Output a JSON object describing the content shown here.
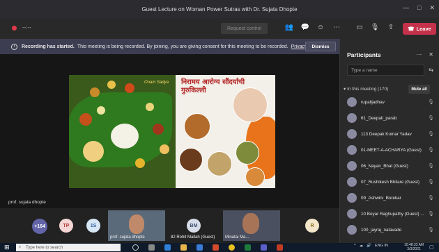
{
  "window": {
    "title": "Guest Lecture on Woman Power Sutras with Dr. Sujata Dhopte"
  },
  "toolbar": {
    "request_control": "Request control",
    "leave_label": "Leave",
    "timer": "--:--"
  },
  "banner": {
    "bold": "Recording has started.",
    "text": "This meeting is being recorded. By joining, you are giving consent for this meeting to be recorded.",
    "link": "Privacy policy",
    "dismiss": "Dismiss"
  },
  "slide": {
    "left_tag": "Onam Sadya",
    "title": "निरामय आरोग्य सौंदर्याची गुरुकिल्ली"
  },
  "presenter": {
    "name": "prof. sujata dhopte"
  },
  "strip": {
    "overflow_count": "+164",
    "avatars": [
      "TP",
      "1S",
      "BM",
      "R"
    ],
    "tiles": [
      "prof. sujata dhopte",
      "82 Rohit Mallah (Guest)",
      "Minatai Ma..."
    ]
  },
  "panel": {
    "title": "Participants",
    "search_placeholder": "Type a name",
    "in_meeting": "In this meeting (170)",
    "mute_all": "Mute all",
    "participants": [
      "rupalijadhav",
      "61_Deepali_parab",
      "113 Deepak Kumar Yadav",
      "01-MEET-A-ACHARYA (Guest)",
      "06_Nayan_Bhat (Guest)",
      "07_Rushikesh Bhilare (Guest)",
      "09_Ashwini_Borekar",
      "10 Boyar Raghupathy (Guest) ...",
      "100_jayraj_nalavade"
    ]
  },
  "taskbar": {
    "search_placeholder": "Type here to search",
    "lang": "ENG IN",
    "time": "10:48:33 AM",
    "date": "3/3/2021"
  },
  "colors": {
    "accent": "#6264a7",
    "leave": "#c4314b",
    "rec": "#e0394b"
  }
}
